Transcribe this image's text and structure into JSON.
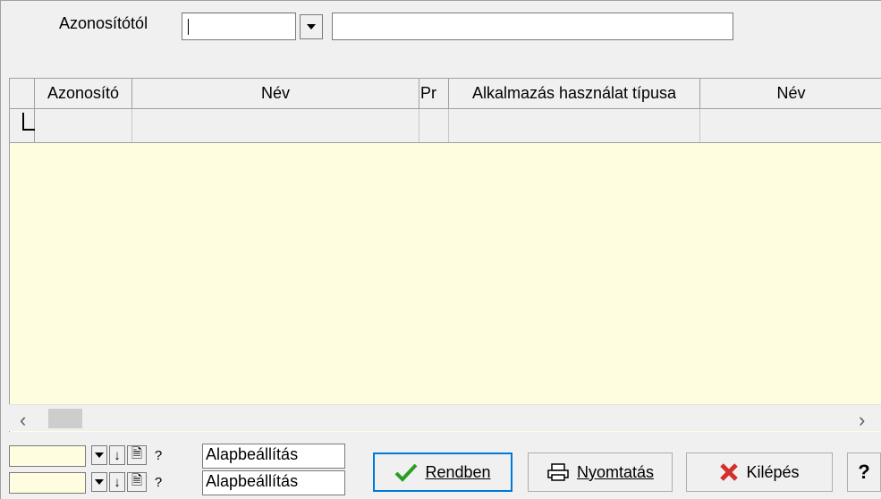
{
  "filter": {
    "label": "Azonosítótól",
    "combo_value": "",
    "text_value": ""
  },
  "grid": {
    "columns": [
      "Azonosító",
      "Név",
      "Pr",
      "Alkalmazás használat típusa",
      "Név"
    ],
    "rows": [
      [
        "",
        "",
        "",
        "",
        ""
      ]
    ]
  },
  "settings": [
    {
      "label": "Alapbeállítás"
    },
    {
      "label": "Alapbeállítás"
    }
  ],
  "buttons": {
    "ok_label": "Rendben",
    "print_label": "Nyomtatás",
    "exit_label": "Kilépés",
    "help_label": "?"
  },
  "colors": {
    "grid_background": "#fffde0",
    "ok_icon": "#2a9d24",
    "exit_icon": "#d32f2f",
    "accent": "#0078d7"
  }
}
